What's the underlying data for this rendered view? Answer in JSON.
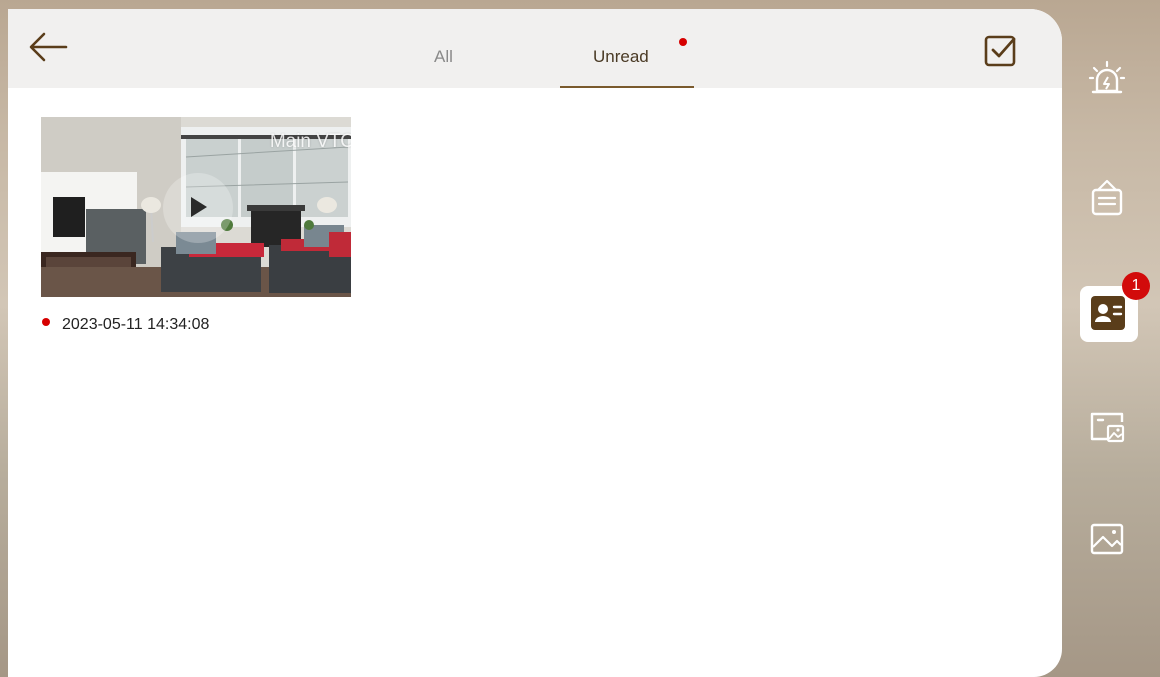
{
  "tabs": [
    {
      "label": "All"
    },
    {
      "label": "Unread"
    }
  ],
  "active_tab": "Unread",
  "records": [
    {
      "channel": "Main VTO",
      "time": "2023-05-11 14:34:08",
      "unread": true
    }
  ],
  "sidebar": {
    "items": [
      {
        "icon": "alarm-icon"
      },
      {
        "icon": "notice-board-icon"
      },
      {
        "icon": "visitor-message-icon",
        "badge": "1",
        "active": true
      },
      {
        "icon": "video-records-icon"
      },
      {
        "icon": "pictures-icon"
      }
    ]
  },
  "colors": {
    "accent": "#7a5a2d",
    "unread_dot": "#d60000",
    "badge": "#d20b0b",
    "topbar": "#f1f0ef"
  }
}
